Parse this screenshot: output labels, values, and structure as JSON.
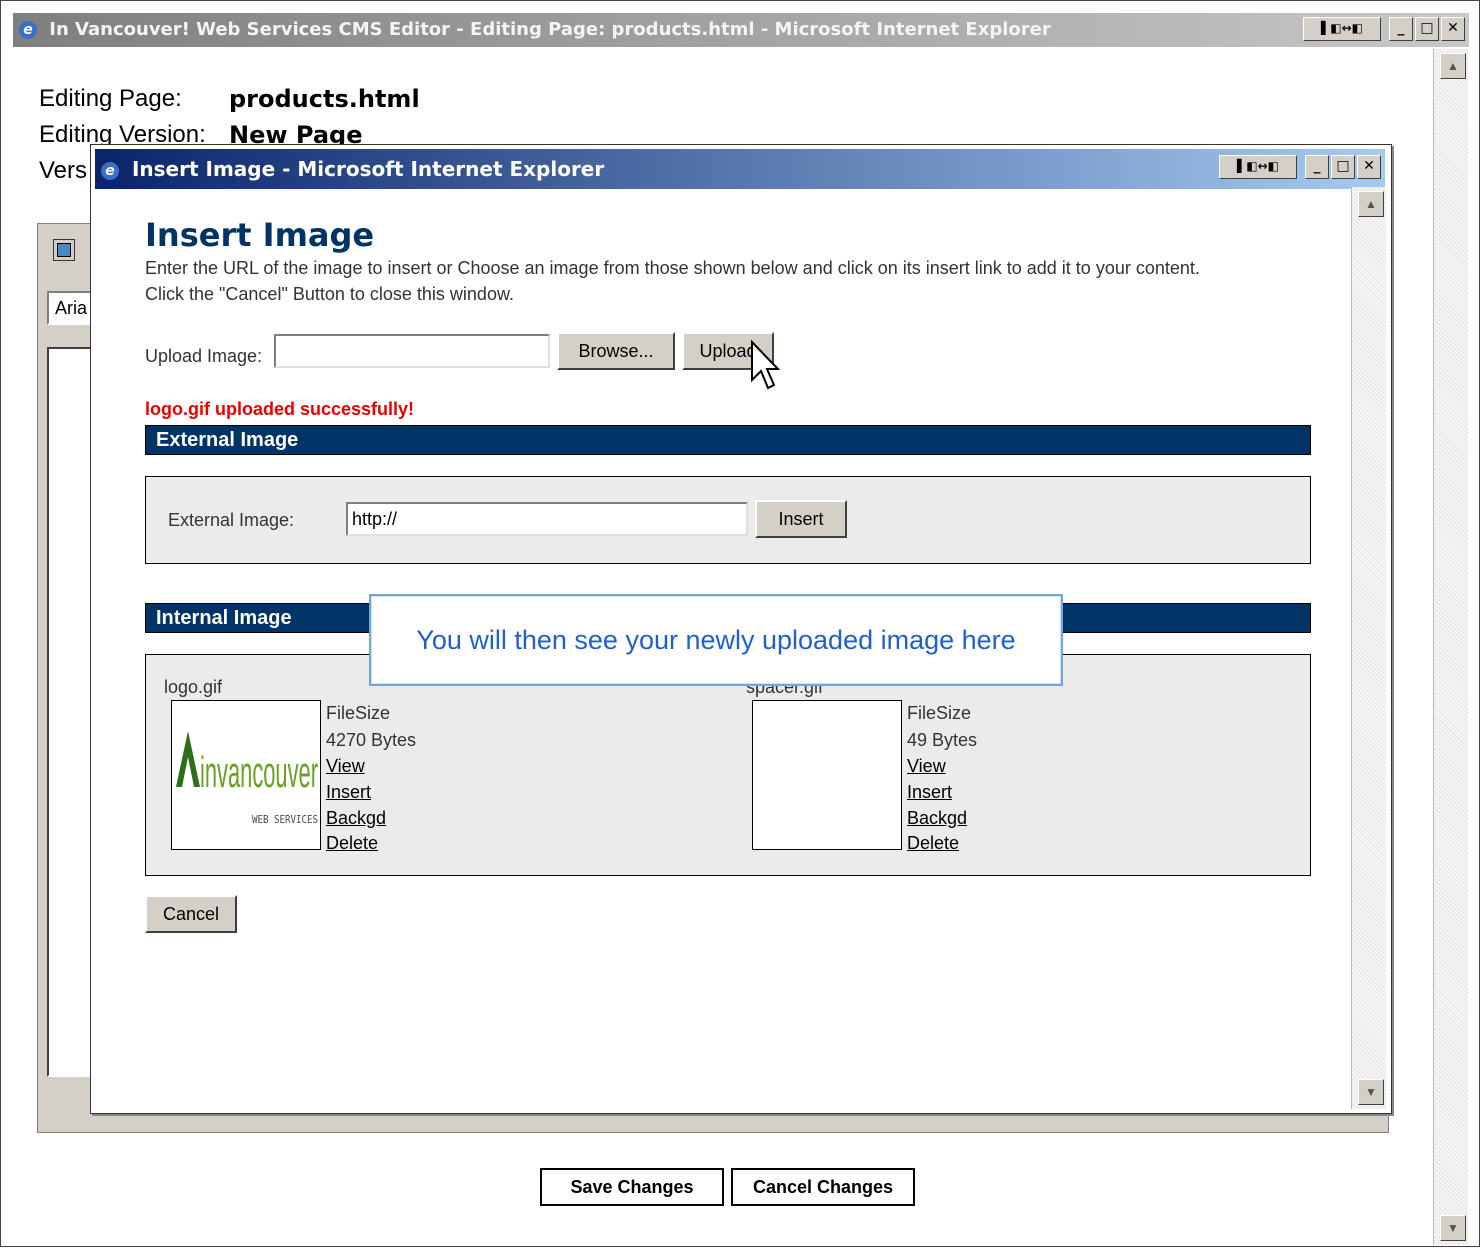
{
  "outer_window": {
    "title": "In Vancouver! Web Services CMS Editor - Editing Page: products.html - Microsoft Internet Explorer"
  },
  "page": {
    "editing_page_label": "Editing Page:",
    "editing_page_value": "products.html",
    "editing_version_label": "Editing Version:",
    "editing_version_value": "New Page",
    "version_label_fragment": "Vers",
    "font_fragment": "Aria",
    "save_button": "Save Changes",
    "cancel_button": "Cancel Changes"
  },
  "dialog": {
    "title": "Insert Image - Microsoft Internet Explorer",
    "heading": "Insert Image",
    "description_line1": "Enter the URL of the image to insert or Choose an image from those shown below and click on its insert link to add it to your content.",
    "description_line2": "Click the \"Cancel\" Button to close this window.",
    "upload_label": "Upload Image:",
    "upload_value": "",
    "browse_button": "Browse...",
    "upload_button": "Upload",
    "success_message": "logo.gif uploaded successfully!",
    "external_section_title": "External Image",
    "external_label": "External Image:",
    "external_value": "http://",
    "insert_button": "Insert",
    "internal_section_title": "Internal Image",
    "images": [
      {
        "name": "logo.gif",
        "filesize_label": "FileSize",
        "filesize": "4270 Bytes",
        "view": "View",
        "insert": "Insert",
        "backgd": "Backgd",
        "delete": "Delete",
        "logo_text": "invancouver",
        "logo_subtext": "WEB SERVICES"
      },
      {
        "name": "spacer.gif",
        "filesize_label": "FileSize",
        "filesize": "49 Bytes",
        "view": "View",
        "insert": "Insert",
        "backgd": "Backgd",
        "delete": "Delete"
      }
    ],
    "cancel_button": "Cancel"
  },
  "callout": {
    "text": "You will then see your newly uploaded image here"
  },
  "colors": {
    "heading": "#003366",
    "section_bar": "#003366",
    "success": "#ee0000",
    "callout_text": "#1f5fd6"
  }
}
